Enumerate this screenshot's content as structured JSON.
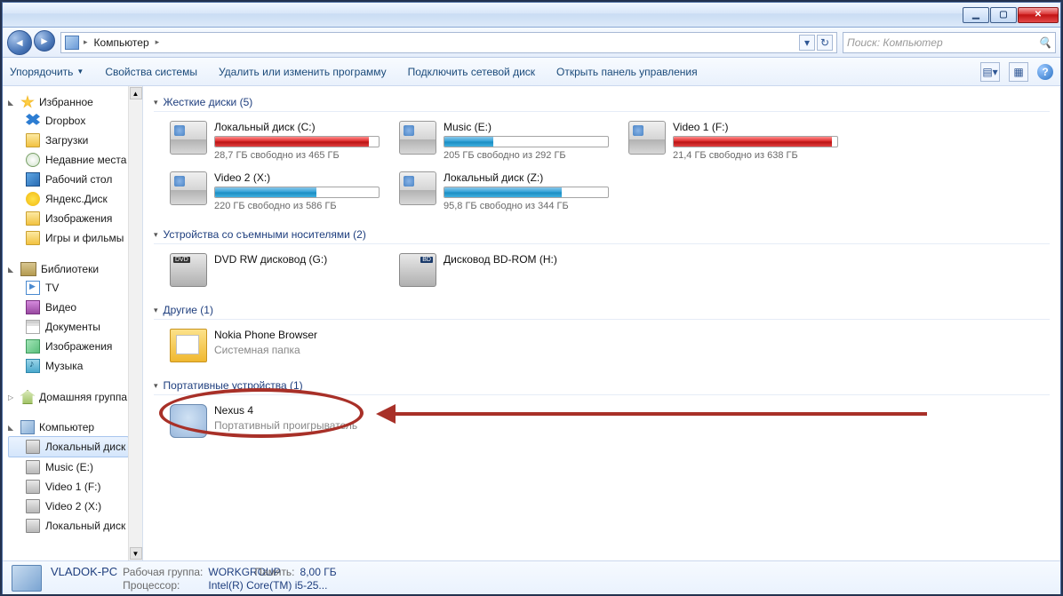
{
  "titlebar": {
    "minimize": "▁",
    "maximize": "▢",
    "close": "✕"
  },
  "nav": {
    "back": "◄",
    "fwd": "►",
    "crumb1": "Компьютер",
    "refresh": "↻",
    "dropdown": "▾",
    "search_placeholder": "Поиск: Компьютер",
    "search_icon": "🔍"
  },
  "toolbar": {
    "organize": "Упорядочить",
    "props": "Свойства системы",
    "uninstall": "Удалить или изменить программу",
    "netdrive": "Подключить сетевой диск",
    "cpanel": "Открыть панель управления",
    "view_icon": "▤",
    "pane_icon": "▦",
    "help": "?"
  },
  "sidebar": {
    "favorites": "Избранное",
    "fav_items": [
      "Dropbox",
      "Загрузки",
      "Недавние места",
      "Рабочий стол",
      "Яндекс.Диск",
      "Изображения",
      "Игры и фильмы"
    ],
    "libraries": "Библиотеки",
    "lib_items": [
      "TV",
      "Видео",
      "Документы",
      "Изображения",
      "Музыка"
    ],
    "homegroup": "Домашняя группа",
    "computer": "Компьютер",
    "comp_items": [
      "Локальный диск",
      "Music (E:)",
      "Video 1 (F:)",
      "Video 2 (X:)",
      "Локальный диск"
    ]
  },
  "sections": {
    "hdd_title": "Жесткие диски (5)",
    "removable_title": "Устройства со съемными носителями (2)",
    "other_title": "Другие (1)",
    "portable_title": "Портативные устройства (1)"
  },
  "drives": [
    {
      "name": "Локальный диск (C:)",
      "free": "28,7 ГБ свободно из 465 ГБ",
      "pct": 94,
      "color": "red"
    },
    {
      "name": "Music (E:)",
      "free": "205 ГБ свободно из 292 ГБ",
      "pct": 30,
      "color": "blue"
    },
    {
      "name": "Video 1 (F:)",
      "free": "21,4 ГБ свободно из 638 ГБ",
      "pct": 97,
      "color": "red"
    },
    {
      "name": "Video 2 (X:)",
      "free": "220 ГБ свободно из 586 ГБ",
      "pct": 62,
      "color": "blue"
    },
    {
      "name": "Локальный диск (Z:)",
      "free": "95,8 ГБ свободно из 344 ГБ",
      "pct": 72,
      "color": "blue"
    }
  ],
  "removable": [
    {
      "name": "DVD RW дисковод (G:)"
    },
    {
      "name": "Дисковод BD-ROM (H:)"
    }
  ],
  "other": [
    {
      "name": "Nokia Phone Browser",
      "sub": "Системная папка"
    }
  ],
  "portable": [
    {
      "name": "Nexus 4",
      "sub": "Портативный проигрыватель"
    }
  ],
  "status": {
    "pc_name": "VLADOK-PC",
    "wg_label": "Рабочая группа:",
    "wg_value": "WORKGROUP",
    "cpu_label": "Процессор:",
    "cpu_value": "Intel(R) Core(TM) i5-25...",
    "mem_label": "Память:",
    "mem_value": "8,00 ГБ"
  }
}
